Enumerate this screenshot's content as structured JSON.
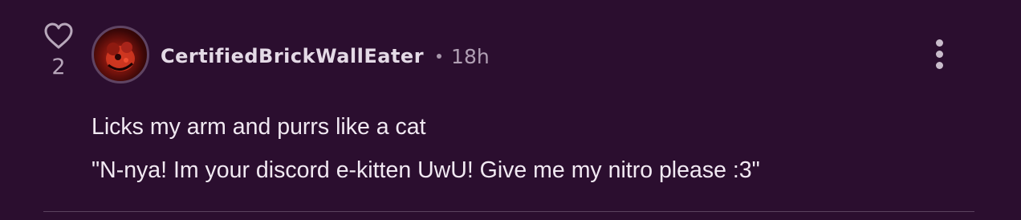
{
  "comment": {
    "likes": {
      "icon": "heart-outline-icon",
      "count": "2"
    },
    "author": {
      "username": "CertifiedBrickWallEater",
      "avatar_icon": "avatar-image"
    },
    "separator": "•",
    "timestamp": "18h",
    "menu_icon": "more-vertical-icon",
    "body_lines": [
      "Licks my arm and purrs like a cat",
      "\"N-nya! Im your discord e-kitten UwU! Give me my nitro please :3\""
    ]
  },
  "colors": {
    "background": "#2b0e2f",
    "text": "#f1e9f2",
    "muted": "#b09fb3",
    "divider": "#5a425e"
  }
}
